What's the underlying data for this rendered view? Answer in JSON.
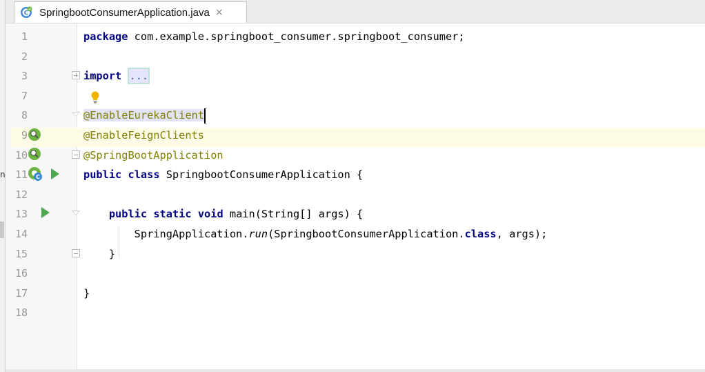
{
  "tab": {
    "icon": "spring-boot-class-icon",
    "label": "SpringbootConsumerApplication.java",
    "close": "×"
  },
  "left_edge_text": "n",
  "lines": [
    {
      "num": "1",
      "tokens": [
        {
          "t": "package",
          "c": "kw"
        },
        {
          "t": " com.example.springboot_consumer.springboot_consumer;",
          "c": ""
        }
      ]
    },
    {
      "num": "2",
      "tokens": []
    },
    {
      "num": "3",
      "tokens": [
        {
          "t": "import",
          "c": "kw"
        },
        {
          "t": " ",
          "c": ""
        },
        {
          "t": "...",
          "c": "folded"
        }
      ]
    },
    {
      "num": "7",
      "tokens": []
    },
    {
      "num": "8",
      "tokens": [
        {
          "t": "@EnableEurekaClient",
          "c": "ann sel"
        }
      ]
    },
    {
      "num": "9",
      "tokens": [
        {
          "t": "@EnableFeignClients",
          "c": "ann"
        }
      ]
    },
    {
      "num": "10",
      "tokens": [
        {
          "t": "@SpringBootApplication",
          "c": "ann"
        }
      ]
    },
    {
      "num": "11",
      "tokens": [
        {
          "t": "public",
          "c": "kw"
        },
        {
          "t": " ",
          "c": ""
        },
        {
          "t": "class",
          "c": "kw"
        },
        {
          "t": " SpringbootConsumerApplication {",
          "c": ""
        }
      ]
    },
    {
      "num": "12",
      "tokens": []
    },
    {
      "num": "13",
      "tokens": [
        {
          "t": "    ",
          "c": ""
        },
        {
          "t": "public",
          "c": "kw"
        },
        {
          "t": " ",
          "c": ""
        },
        {
          "t": "static",
          "c": "kw"
        },
        {
          "t": " ",
          "c": ""
        },
        {
          "t": "void",
          "c": "kw"
        },
        {
          "t": " main(String[] args) {",
          "c": ""
        }
      ]
    },
    {
      "num": "14",
      "tokens": [
        {
          "t": "        SpringApplication.",
          "c": ""
        },
        {
          "t": "run",
          "c": "call"
        },
        {
          "t": "(SpringbootConsumerApplication.",
          "c": ""
        },
        {
          "t": "class",
          "c": "kw"
        },
        {
          "t": ", args);",
          "c": ""
        }
      ]
    },
    {
      "num": "15",
      "tokens": [
        {
          "t": "    }",
          "c": ""
        }
      ]
    },
    {
      "num": "16",
      "tokens": []
    },
    {
      "num": "17",
      "tokens": [
        {
          "t": "}",
          "c": ""
        }
      ]
    },
    {
      "num": "18",
      "tokens": []
    }
  ],
  "gutter_icons": {
    "line9": "bean-search-icon",
    "line10": "bean-search-icon",
    "line11": [
      "spring-bean-icon",
      "run-icon"
    ],
    "line13": "run-icon",
    "line7": "lightbulb-icon"
  },
  "colors": {
    "keyword": "#000080",
    "annotation": "#808000",
    "current_line": "#fdfbe6",
    "run_green": "#4fa84f"
  }
}
